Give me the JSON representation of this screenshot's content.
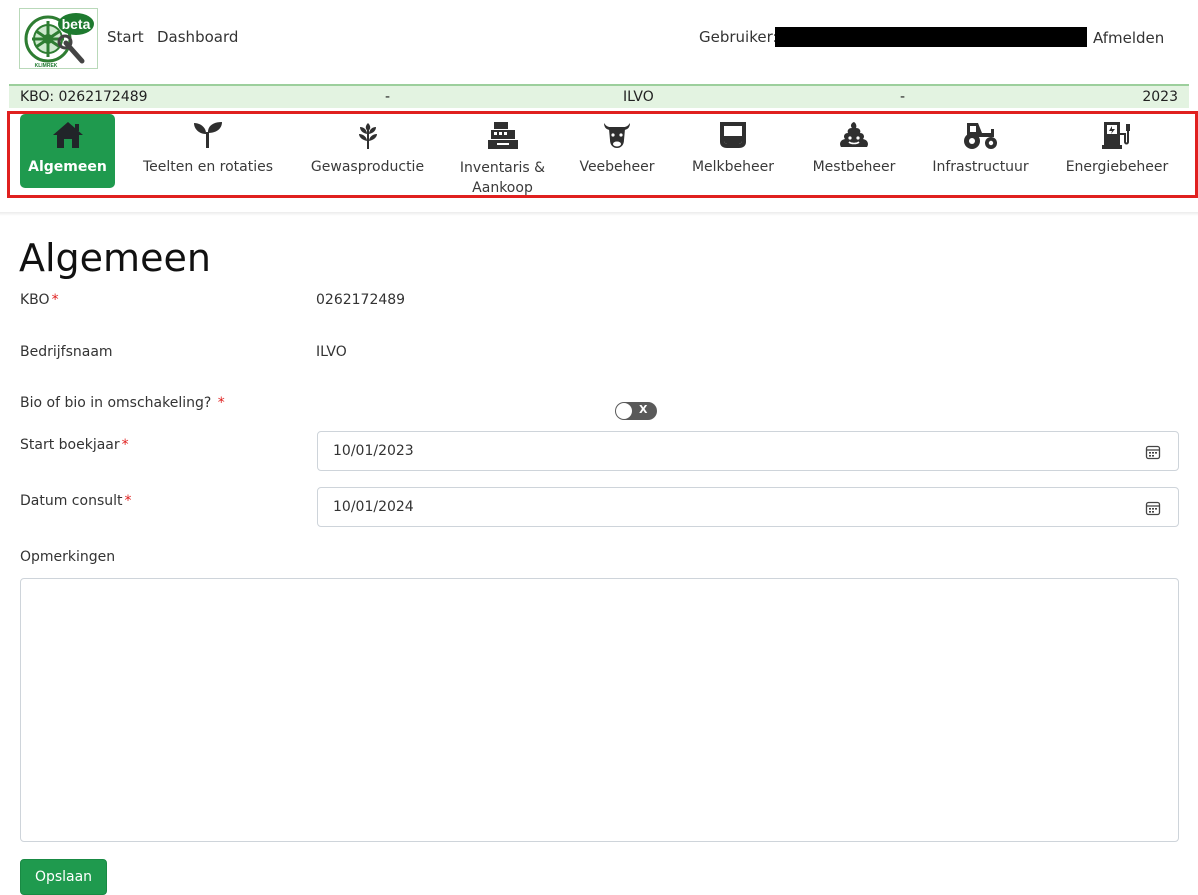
{
  "header": {
    "logo_badge": "beta",
    "logo_caption": "KLIMREK",
    "nav": {
      "start": "Start",
      "dashboard": "Dashboard"
    },
    "user_label": "Gebruiker:",
    "logout": "Afmelden"
  },
  "infobar": {
    "kbo": "KBO: 0262172489",
    "sep1": "-",
    "company": "ILVO",
    "sep2": "-",
    "year": "2023"
  },
  "tabs": [
    {
      "label": "Algemeen",
      "icon": "home-icon",
      "active": true
    },
    {
      "label": "Teelten en rotaties",
      "icon": "sprout-icon",
      "active": false
    },
    {
      "label": "Gewasproductie",
      "icon": "wheat-icon",
      "active": false
    },
    {
      "label": "Inventaris & Aankoop",
      "icon": "cash-register-icon",
      "active": false
    },
    {
      "label": "Veebeheer",
      "icon": "cow-icon",
      "active": false
    },
    {
      "label": "Melkbeheer",
      "icon": "milk-glass-icon",
      "active": false
    },
    {
      "label": "Mestbeheer",
      "icon": "manure-icon",
      "active": false
    },
    {
      "label": "Infrastructuur",
      "icon": "tractor-icon",
      "active": false
    },
    {
      "label": "Energiebeheer",
      "icon": "charging-station-icon",
      "active": false
    }
  ],
  "colors": {
    "primary_green": "#1f9a4e",
    "highlight_red": "#e0201f",
    "infobar_bg": "#e3f3e1"
  },
  "form": {
    "title": "Algemeen",
    "kbo_label": "KBO",
    "kbo_value": "0262172489",
    "company_label": "Bedrijfsnaam",
    "company_value": "ILVO",
    "bio_label": "Bio of bio in omschakeling?",
    "bio_toggle_text": "X",
    "start_label": "Start boekjaar",
    "start_value": "10/01/2023",
    "consult_label": "Datum consult",
    "consult_value": "10/01/2024",
    "remarks_label": "Opmerkingen",
    "remarks_value": "",
    "required_marker": "*",
    "save_label": "Opslaan"
  }
}
